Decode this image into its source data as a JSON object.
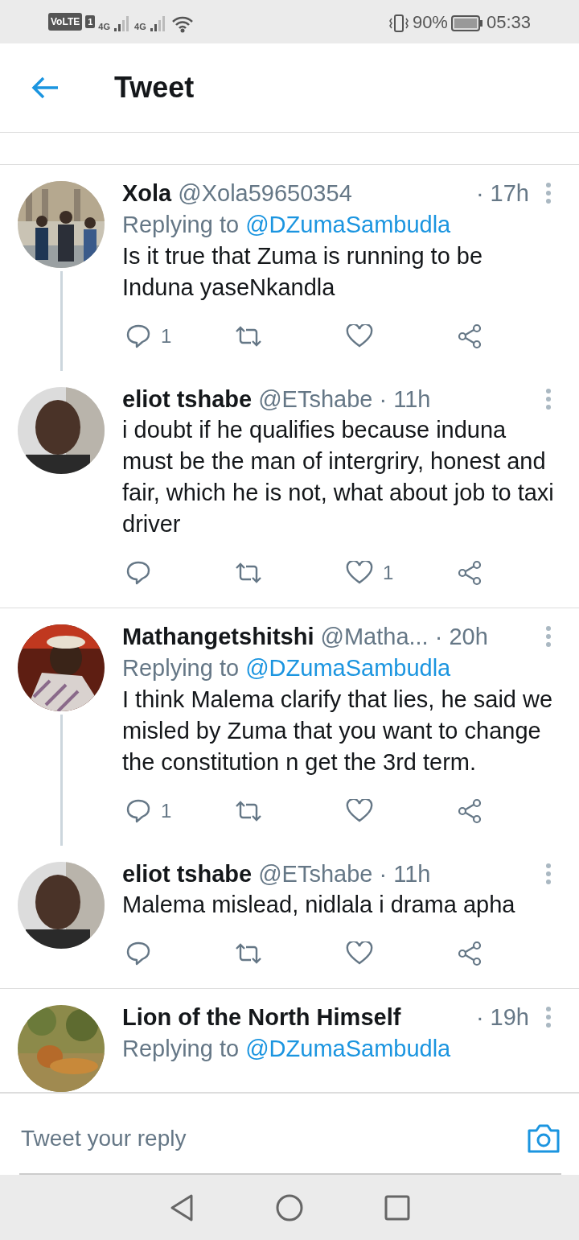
{
  "status_bar": {
    "volte": "VoLTE",
    "sim": "1",
    "network_1": "4G",
    "network_2": "4G",
    "battery": "90%",
    "time": "05:33"
  },
  "header": {
    "title": "Tweet"
  },
  "tweets": [
    {
      "name": "Xola",
      "handle": "@Xola59650354",
      "time": "· 17h",
      "replying_to": "@DZumaSambudla",
      "replying_label": "Replying to",
      "text": "Is it true that Zuma is running to be Induna yaseNkandla",
      "reply_count": "1",
      "connected_below": true
    },
    {
      "name": "eliot tshabe",
      "handle": "@ETshabe",
      "time": "· 11h",
      "text": "i doubt if he qualifies because induna must be the man of intergriry, honest and fair, which he is not, what about job to taxi driver",
      "like_count": "1",
      "connected_below": false
    },
    {
      "name": "Mathangetshitshi",
      "handle": "@Matha...",
      "time": "· 20h",
      "replying_to": "@DZumaSambudla",
      "replying_label": "Replying to",
      "text": "I think Malema clarify that lies, he said we misled by Zuma that you want to change the constitution n get the 3rd term.",
      "reply_count": "1",
      "connected_below": true
    },
    {
      "name": "eliot tshabe",
      "handle": "@ETshabe",
      "time": "· 11h",
      "text": "Malema mislead, nidlala i drama apha",
      "connected_below": false
    },
    {
      "name": "Lion of the North Himself",
      "time": "· 19h",
      "replying_to": "@DZumaSambudla",
      "replying_label": "Replying to",
      "connected_below": false
    }
  ],
  "reply_bar": {
    "placeholder": "Tweet your reply"
  }
}
